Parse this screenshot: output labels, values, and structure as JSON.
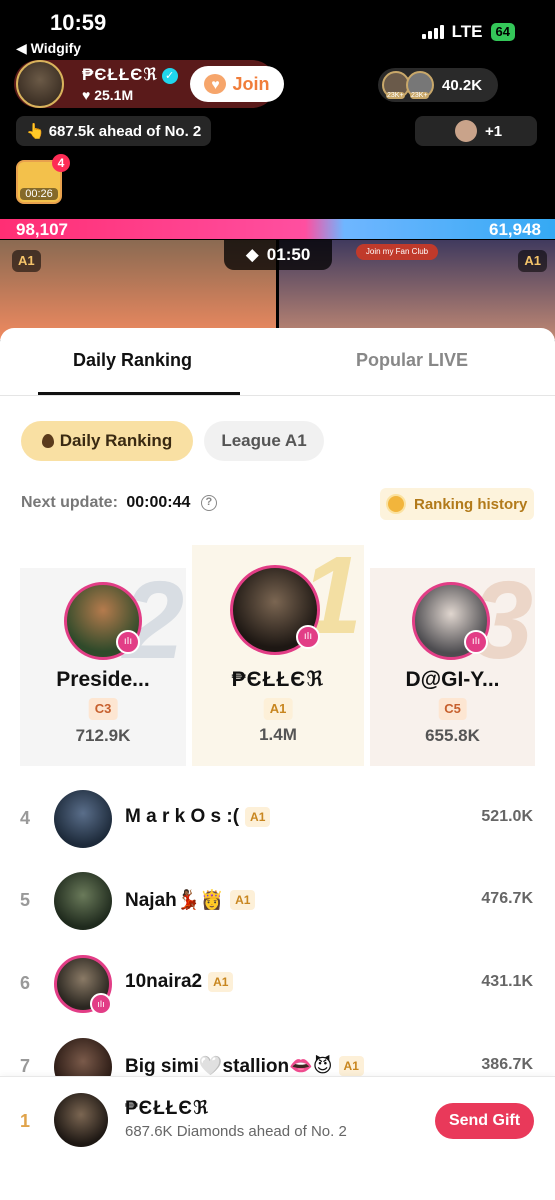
{
  "status": {
    "time": "10:59",
    "back_app": "◀ Widgify",
    "network": "LTE",
    "battery": "64"
  },
  "host": {
    "name": "₱ЄŁŁЄℜ",
    "likes": "25.1M",
    "join_label": "Join"
  },
  "viewers": {
    "badge_1": "23K+",
    "badge_2": "23K+",
    "count": "40.2K"
  },
  "ahead": {
    "text": "687.5k ahead of No. 2",
    "plus": "+1"
  },
  "gift": {
    "badge": "4",
    "timer": "00:26"
  },
  "pk": {
    "left_score": "98,107",
    "right_score": "61,948",
    "timer": "01:50",
    "tier_left": "A1",
    "tier_right": "A1",
    "fan_club": "Join my Fan Club"
  },
  "tabs": {
    "daily": "Daily Ranking",
    "popular": "Popular LIVE"
  },
  "chips": {
    "daily": "Daily Ranking",
    "league": "League A1"
  },
  "update": {
    "label": "Next update:",
    "value": "00:00:44",
    "history": "Ranking history"
  },
  "podium": [
    {
      "rank": "2",
      "name": "Preside...",
      "tier": "C3",
      "score": "712.9K"
    },
    {
      "rank": "1",
      "name": "₱ЄŁŁЄℜ",
      "tier": "A1",
      "score": "1.4M"
    },
    {
      "rank": "3",
      "name": "D@GI-Y...",
      "tier": "C5",
      "score": "655.8K"
    }
  ],
  "rows": [
    {
      "rank": "4",
      "name": "M a r k O s :(",
      "tier": "A1",
      "score": "521.0K"
    },
    {
      "rank": "5",
      "name": "Najah💃🏾👸",
      "tier": "A1",
      "score": "476.7K"
    },
    {
      "rank": "6",
      "name": "10naira2",
      "tier": "A1",
      "score": "431.1K"
    },
    {
      "rank": "7",
      "name": "Big simi🤍stallion👄😈",
      "tier": "A1",
      "score": "386.7K"
    }
  ],
  "me": {
    "rank": "1",
    "name": "₱ЄŁŁЄℜ",
    "sub": "687.6K Diamonds ahead of No. 2",
    "gift_label": "Send Gift"
  },
  "colors": {
    "accent": "#e9395a",
    "live_ring": "#e23d86",
    "gold": "#c8861f"
  }
}
